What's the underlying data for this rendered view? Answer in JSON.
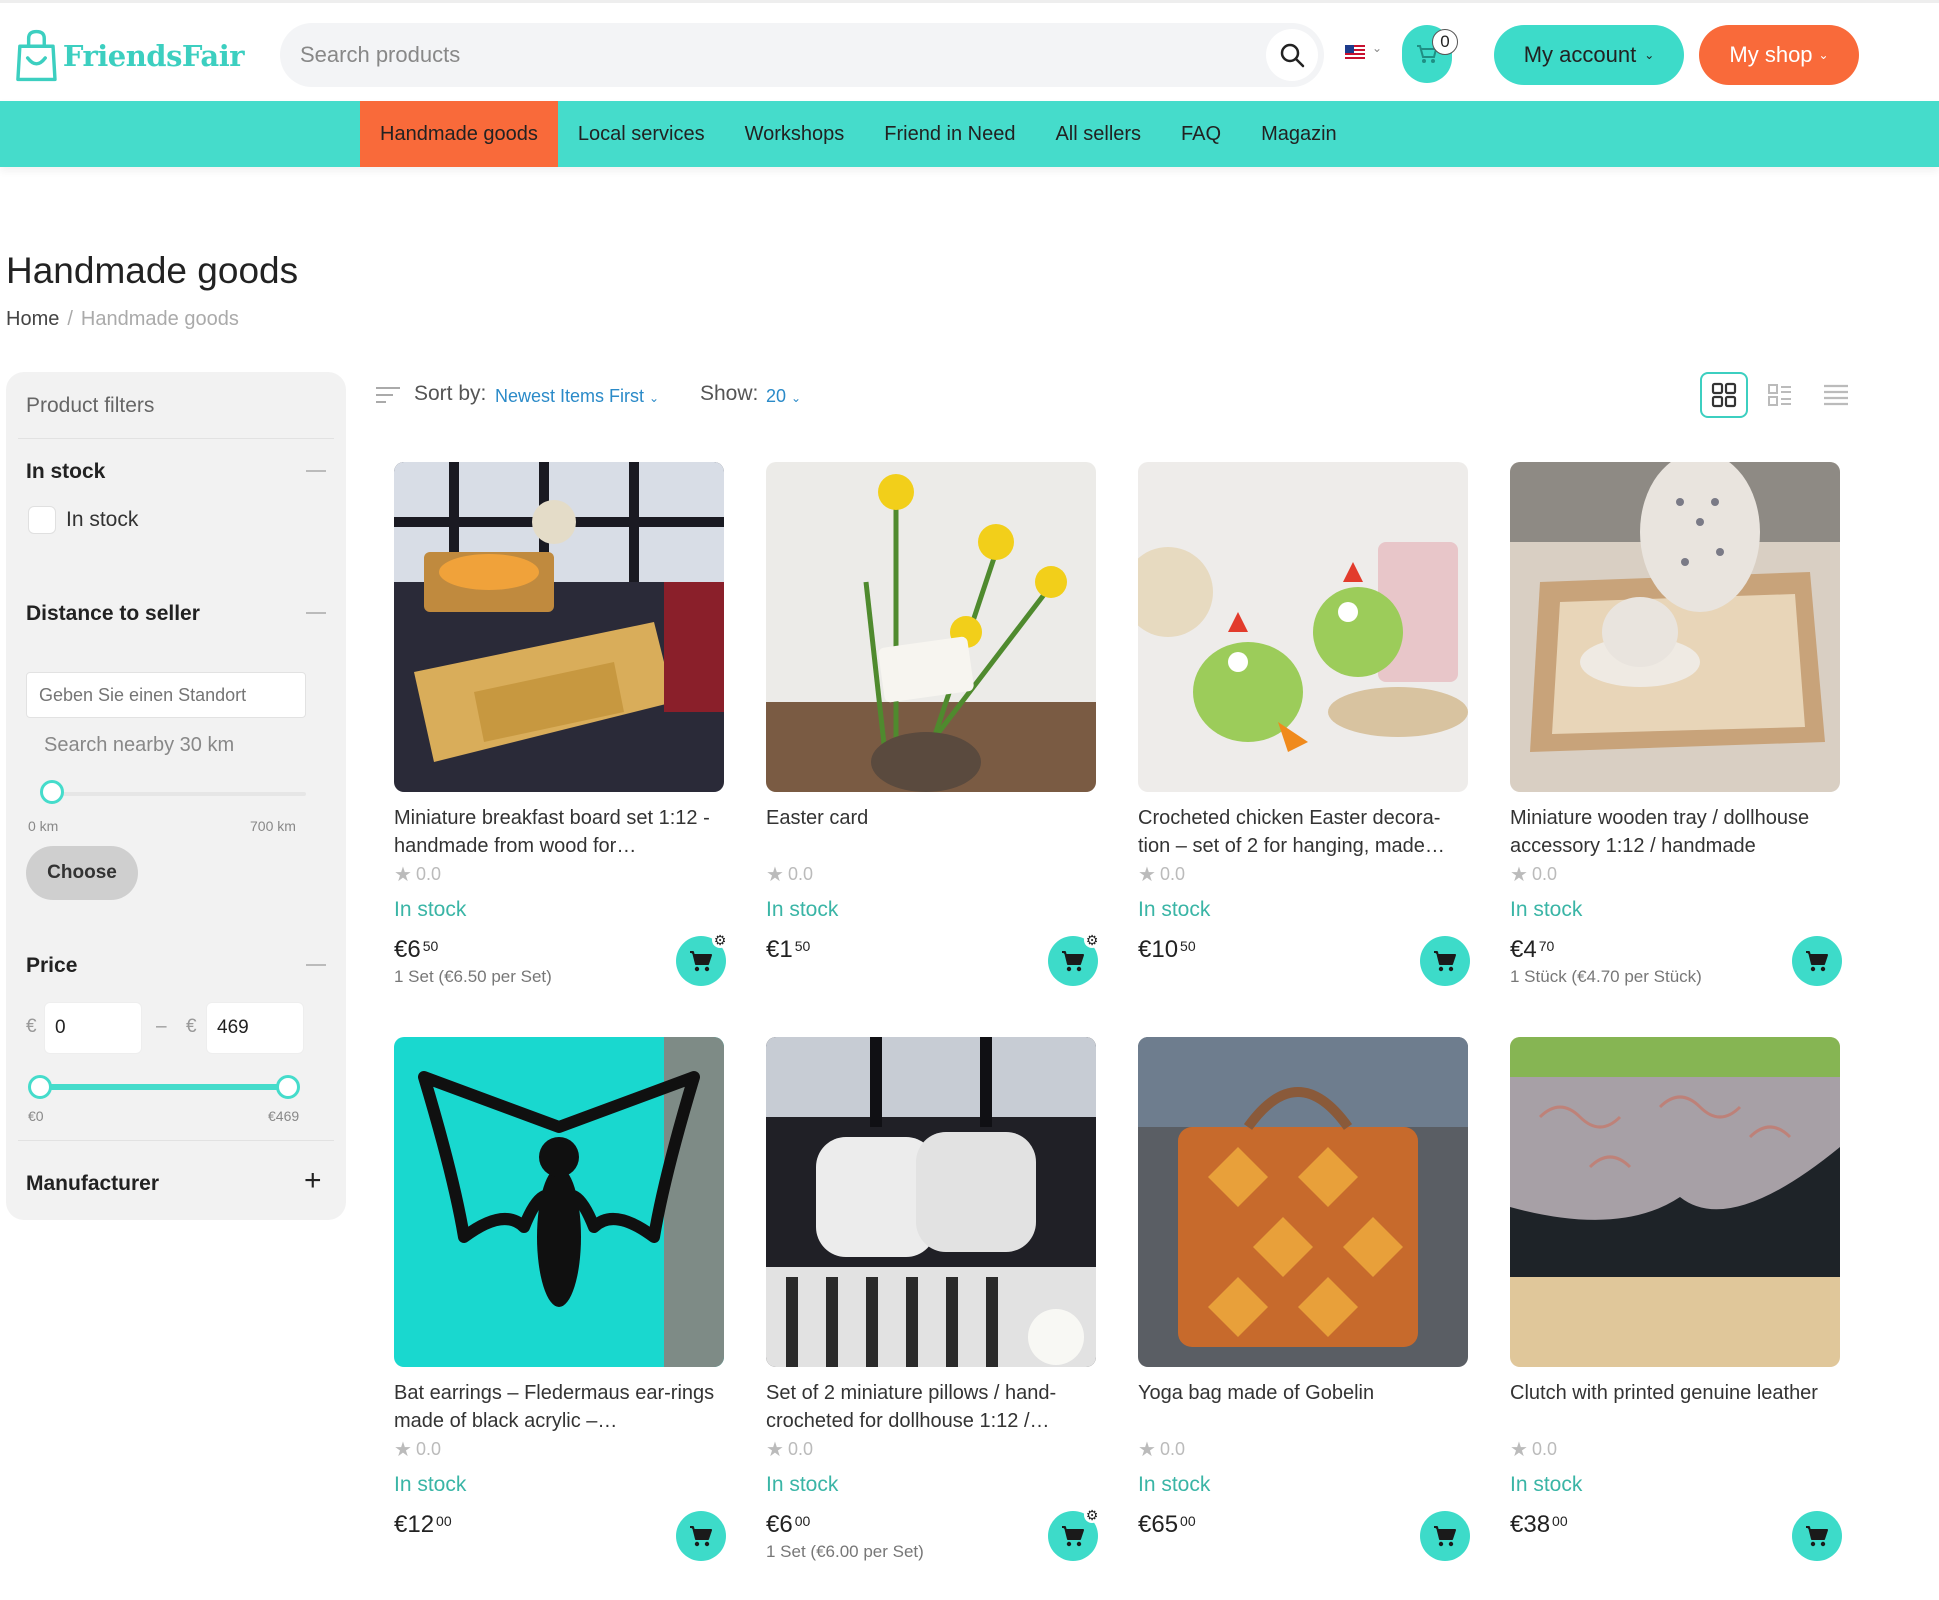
{
  "header": {
    "logo_text": "FriendsFair",
    "search_placeholder": "Search products",
    "cart_count": "0",
    "account_label": "My account",
    "shop_label": "My shop"
  },
  "nav": [
    {
      "label": "Handmade goods",
      "active": true
    },
    {
      "label": "Local services"
    },
    {
      "label": "Workshops"
    },
    {
      "label": "Friend in Need"
    },
    {
      "label": "All sellers"
    },
    {
      "label": "FAQ"
    },
    {
      "label": "Magazin"
    }
  ],
  "page": {
    "title": "Handmade goods",
    "breadcrumb": {
      "home": "Home",
      "sep": "/",
      "current": "Handmade goods"
    }
  },
  "filters": {
    "header": "Product filters",
    "in_stock_section": "In stock",
    "in_stock_option": "In stock",
    "distance_section": "Distance to seller",
    "location_placeholder": "Geben Sie einen Standort",
    "nearby_text": "Search nearby 30 km",
    "distance_min_label": "0 km",
    "distance_max_label": "700 km",
    "choose_label": "Choose",
    "price_section": "Price",
    "currency": "€",
    "price_min": "0",
    "price_max": "469",
    "price_min_label": "€0",
    "price_max_label": "€469",
    "price_dash": "–",
    "manufacturer_section": "Manufacturer"
  },
  "toolbar": {
    "sort_label": "Sort by:",
    "sort_value": "Newest Items First",
    "show_label": "Show:",
    "show_value": "20"
  },
  "products": [
    {
      "title": "Miniature breakfast board set 1:12 - handmade from wood for…",
      "rating": "0.0",
      "stock": "In stock",
      "price_main": "€6",
      "price_cents": "50",
      "unit": "1 Set (€6.50 per Set)",
      "cart_variant": "options"
    },
    {
      "title": "Easter card",
      "rating": "0.0",
      "stock": "In stock",
      "price_main": "€1",
      "price_cents": "50",
      "unit": "",
      "cart_variant": "options"
    },
    {
      "title": "Crocheted chicken Easter decora-tion – set of 2 for hanging, made…",
      "rating": "0.0",
      "stock": "In stock",
      "price_main": "€10",
      "price_cents": "50",
      "unit": "",
      "cart_variant": "plain"
    },
    {
      "title": "Miniature wooden tray / dollhouse accessory 1:12 / handmade",
      "rating": "0.0",
      "stock": "In stock",
      "price_main": "€4",
      "price_cents": "70",
      "unit": "1 Stück (€4.70 per Stück)",
      "cart_variant": "plain"
    },
    {
      "title": "Bat earrings – Fledermaus ear-rings made of black acrylic –…",
      "rating": "0.0",
      "stock": "In stock",
      "price_main": "€12",
      "price_cents": "00",
      "unit": "",
      "cart_variant": "plain"
    },
    {
      "title": "Set of 2 miniature pillows / hand-crocheted for dollhouse 1:12 /…",
      "rating": "0.0",
      "stock": "In stock",
      "price_main": "€6",
      "price_cents": "00",
      "unit": "1 Set (€6.00 per Set)",
      "cart_variant": "options"
    },
    {
      "title": "Yoga bag made of Gobelin",
      "rating": "0.0",
      "stock": "In stock",
      "price_main": "€65",
      "price_cents": "00",
      "unit": "",
      "cart_variant": "plain"
    },
    {
      "title": "Clutch with printed genuine leather",
      "rating": "0.0",
      "stock": "In stock",
      "price_main": "€38",
      "price_cents": "00",
      "unit": "",
      "cart_variant": "plain"
    }
  ],
  "colors": {
    "accent": "#45dccb",
    "brand": "#3ccfc0",
    "shop": "#f96a3a",
    "stock": "#3ab5a6",
    "link": "#2a8ac8"
  },
  "icons": {
    "search": "search-icon",
    "cart": "cart-icon",
    "flag": "us-flag-icon",
    "gear": "gear-icon",
    "star": "star-icon"
  }
}
